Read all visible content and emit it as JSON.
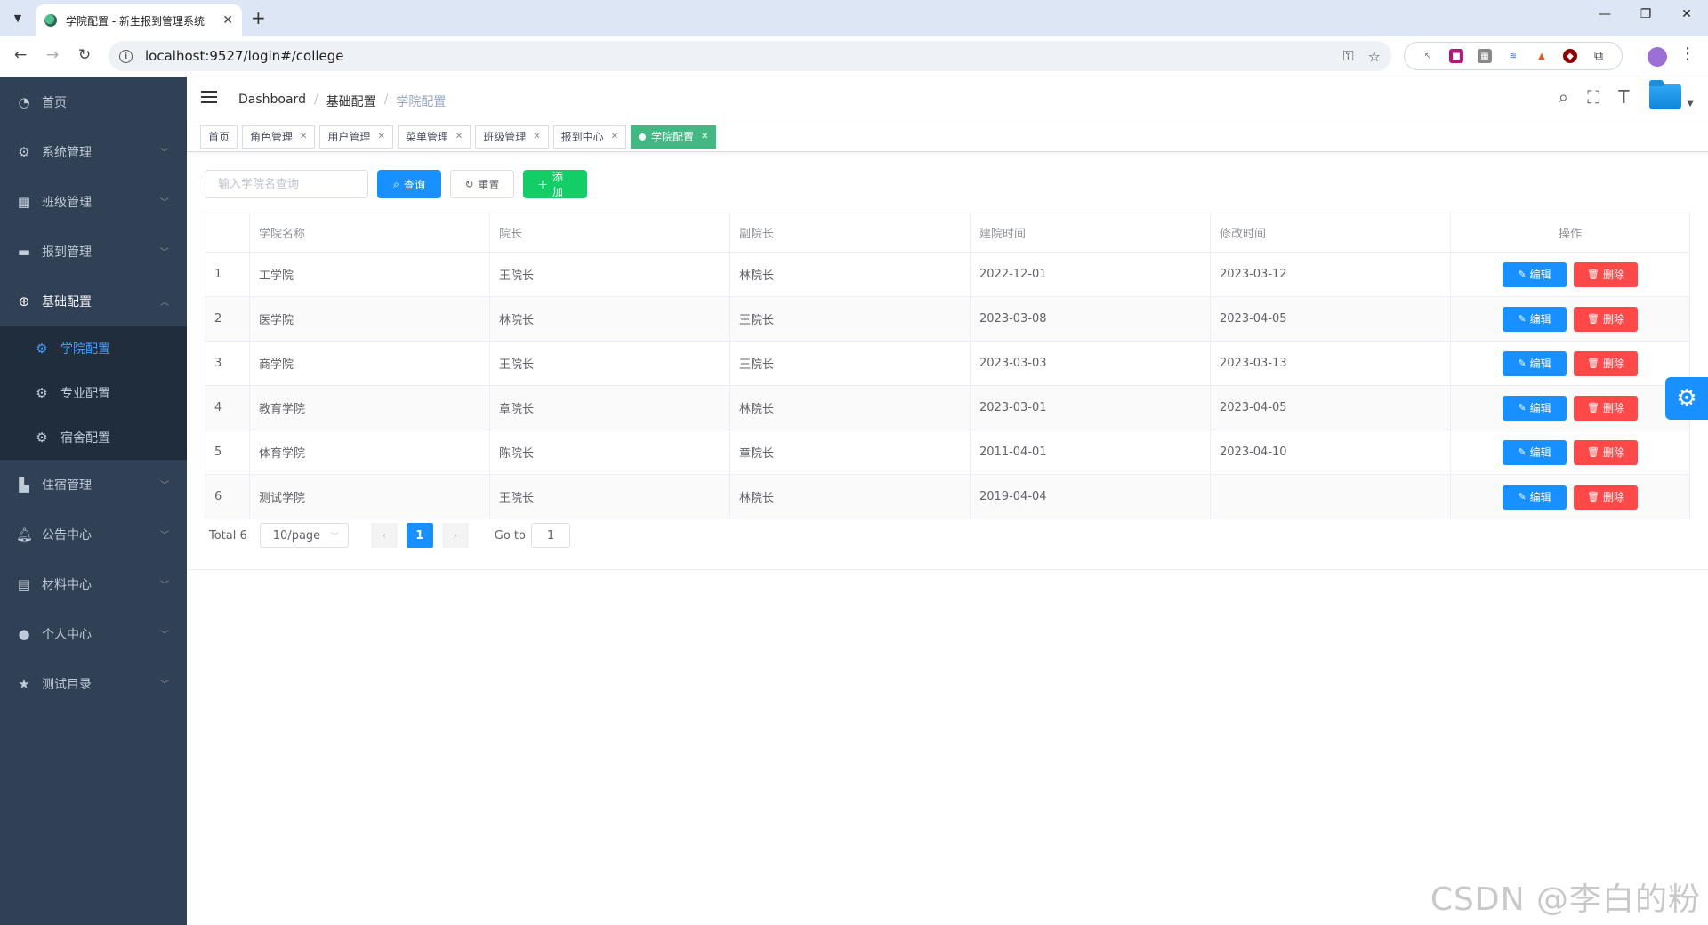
{
  "browser": {
    "tab_title": "学院配置 - 新生报到管理系统",
    "url": "localhost:9527/login#/college"
  },
  "sidebar": {
    "items": [
      {
        "label": "首页",
        "icon": "dashboard-icon"
      },
      {
        "label": "系统管理",
        "icon": "gear-icon"
      },
      {
        "label": "班级管理",
        "icon": "grid-icon"
      },
      {
        "label": "报到管理",
        "icon": "monitor-icon"
      },
      {
        "label": "基础配置",
        "icon": "plus-circle-icon"
      },
      {
        "label": "住宿管理",
        "icon": "chart-icon"
      },
      {
        "label": "公告中心",
        "icon": "bell-icon"
      },
      {
        "label": "材料中心",
        "icon": "clipboard-icon"
      },
      {
        "label": "个人中心",
        "icon": "user-icon"
      },
      {
        "label": "测试目录",
        "icon": "star-icon"
      }
    ],
    "submenu": [
      {
        "label": "学院配置"
      },
      {
        "label": "专业配置"
      },
      {
        "label": "宿舍配置"
      }
    ]
  },
  "breadcrumb": [
    "Dashboard",
    "基础配置",
    "学院配置"
  ],
  "tags": [
    "首页",
    "角色管理",
    "用户管理",
    "菜单管理",
    "班级管理",
    "报到中心",
    "学院配置"
  ],
  "filter": {
    "placeholder": "输入学院名查询",
    "query_label": "查询",
    "reset_label": "重置",
    "add_label": "添加"
  },
  "table": {
    "headers": [
      "",
      "学院名称",
      "院长",
      "副院长",
      "建院时间",
      "修改时间",
      "操作"
    ],
    "edit_label": "编辑",
    "delete_label": "删除",
    "rows": [
      {
        "idx": "1",
        "name": "工学院",
        "dean": "王院长",
        "vice": "林院长",
        "created": "2022-12-01",
        "modified": "2023-03-12"
      },
      {
        "idx": "2",
        "name": "医学院",
        "dean": "林院长",
        "vice": "王院长",
        "created": "2023-03-08",
        "modified": "2023-04-05"
      },
      {
        "idx": "3",
        "name": "商学院",
        "dean": "王院长",
        "vice": "王院长",
        "created": "2023-03-03",
        "modified": "2023-03-13"
      },
      {
        "idx": "4",
        "name": "教育学院",
        "dean": "章院长",
        "vice": "林院长",
        "created": "2023-03-01",
        "modified": "2023-04-05"
      },
      {
        "idx": "5",
        "name": "体育学院",
        "dean": "陈院长",
        "vice": "章院长",
        "created": "2011-04-01",
        "modified": "2023-04-10"
      },
      {
        "idx": "6",
        "name": "测试学院",
        "dean": "王院长",
        "vice": "林院长",
        "created": "2019-04-04",
        "modified": ""
      }
    ]
  },
  "pagination": {
    "total": "Total 6",
    "page_size": "10/page",
    "current": "1",
    "goto_label": "Go to",
    "goto_value": "1"
  },
  "watermark": "CSDN @李白的粉",
  "colors": {
    "sidebar_bg": "#304156",
    "primary": "#1890ff",
    "success": "#13ce66",
    "danger": "#ff4949",
    "active_tag": "#42b983"
  }
}
